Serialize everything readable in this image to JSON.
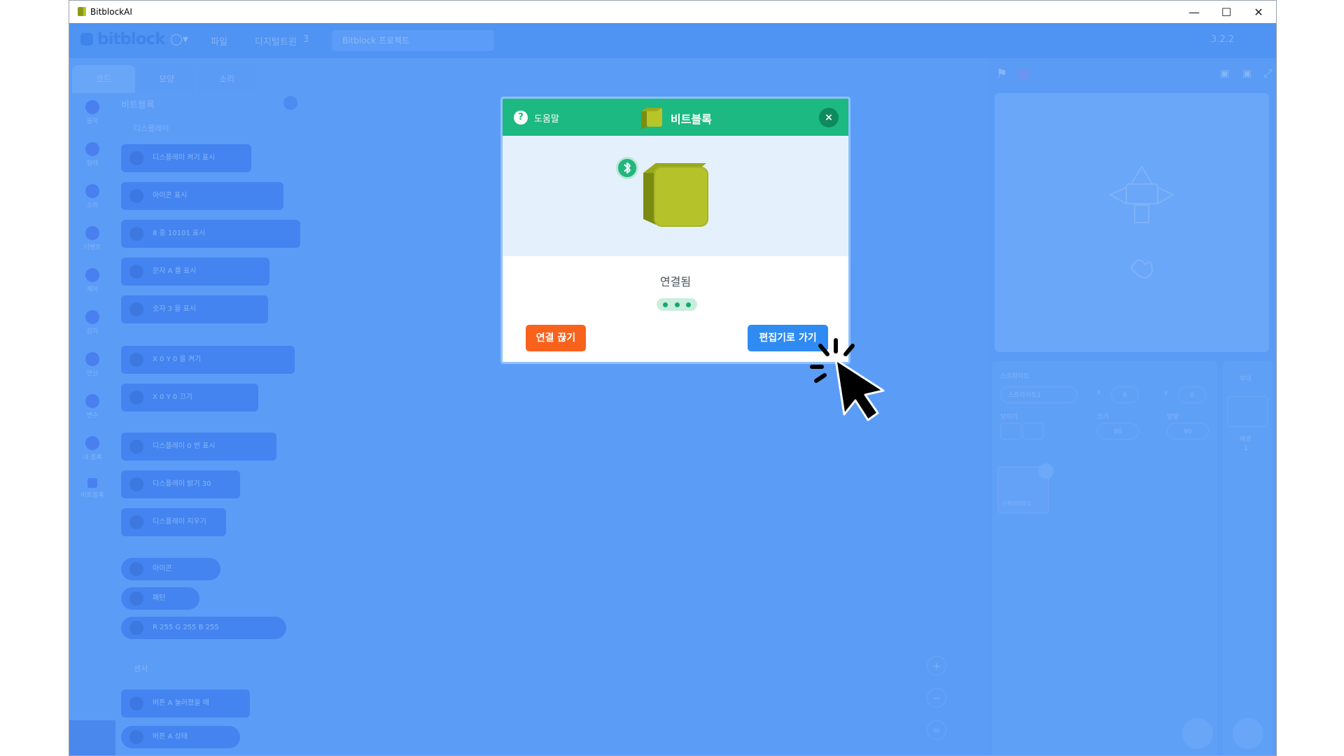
{
  "window": {
    "title": "BitblockAI"
  },
  "menubar": {
    "logo": "bitblock",
    "menu_file": "파일",
    "menu_digital_twin": "디지털트윈",
    "menu_digital_twin_box": "3",
    "project_name": "Bitblock 프로젝트",
    "version": "3.2.2"
  },
  "tabs": [
    {
      "label": "코드"
    },
    {
      "label": "모양"
    },
    {
      "label": "소리"
    }
  ],
  "categories": [
    {
      "label": "동작"
    },
    {
      "label": "형태"
    },
    {
      "label": "소리"
    },
    {
      "label": "이벤트"
    },
    {
      "label": "제어"
    },
    {
      "label": "감지"
    },
    {
      "label": "연산"
    },
    {
      "label": "변수"
    },
    {
      "label": "내 블록"
    },
    {
      "label": "비트블록"
    }
  ],
  "palette": {
    "section_title": "비트블록",
    "subsection_display": "디스플레이",
    "subsection_sensor": "센서",
    "blocks": [
      "디스플레이 켜기 표시",
      "아이콘 표시",
      "8 중 10101 표시",
      "문자 A 를 표시",
      "숫자 3 을 표시",
      "X 0 Y 0 을 켜기",
      "X 0 Y 0 끄기",
      "디스플레이 0 번 표시",
      "디스플레이 밝기 30",
      "디스플레이 지우기",
      "아이콘",
      "패턴",
      "R 255 G 255 B 255",
      "버튼 A 눌러졌을 때",
      "버튼 A 상태"
    ]
  },
  "sprite_panel": {
    "sprite_label": "스프라이트",
    "sprite_name": "스프라이트1",
    "x_label": "x",
    "x_value": "0",
    "y_label": "y",
    "y_value": "0",
    "show_label": "보이기",
    "size_label": "크기",
    "size_value": "80",
    "direction_label": "방향",
    "direction_value": "90",
    "thumb_label": "스프라이트1"
  },
  "backdrop_panel": {
    "stage_label": "무대",
    "backdrop_label": "배경",
    "backdrop_count": "1"
  },
  "dialog": {
    "help_label": "도움말",
    "title": "비트블록",
    "close_icon": "×",
    "status": "연결됨",
    "disconnect_label": "연결 끊기",
    "goto_editor_label": "편집기로 가기"
  },
  "colors": {
    "overlay_blue": "#5b9cf7",
    "dialog_header": "#1cb982",
    "disconnect_button": "#f8621d",
    "goto_editor_button": "#2f8bf2"
  }
}
